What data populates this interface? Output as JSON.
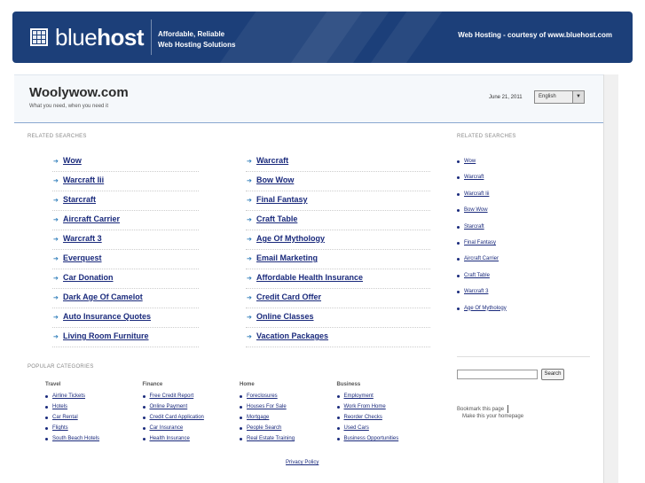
{
  "header": {
    "logo_light": "blue",
    "logo_bold": "host",
    "tagline_1": "Affordable, Reliable",
    "tagline_2": "Web Hosting Solutions",
    "courtesy": "Web Hosting - courtesy of www.bluehost.com",
    "brand_color": "#1c3f79"
  },
  "site": {
    "title": "Woolywow.com",
    "subtitle": "What you need, when you need it",
    "date": "June 21, 2011",
    "language": "English"
  },
  "related": {
    "heading": "RELATED SEARCHES",
    "col1": [
      "Wow",
      "Warcraft Iii",
      "Starcraft",
      "Aircraft Carrier",
      "Warcraft 3",
      "Everquest",
      "Car Donation",
      "Dark Age Of Camelot",
      "Auto Insurance Quotes",
      "Living Room Furniture"
    ],
    "col2": [
      "Warcraft",
      "Bow Wow",
      "Final Fantasy",
      "Craft Table",
      "Age Of Mythology",
      "Email Marketing",
      "Affordable Health Insurance",
      "Credit Card Offer",
      "Online Classes",
      "Vacation Packages"
    ]
  },
  "sidebar": {
    "heading": "RELATED SEARCHES",
    "items": [
      "Wow",
      "Warcraft",
      "Warcraft Iii",
      "Bow Wow",
      "Starcraft",
      "Final Fantasy",
      "Aircraft Carrier",
      "Craft Table",
      "Warcraft 3",
      "Age Of Mythology"
    ],
    "search_button": "Search",
    "bookmark": "Bookmark this page",
    "homepage": "Make this your homepage"
  },
  "popular": {
    "heading": "POPULAR CATEGORIES",
    "categories": [
      {
        "title": "Travel",
        "items": [
          "Airline Tickets",
          "Hotels",
          "Car Rental",
          "Flights",
          "South Beach Hotels"
        ]
      },
      {
        "title": "Finance",
        "items": [
          "Free Credit Report",
          "Online Payment",
          "Credit Card Application",
          "Car Insurance",
          "Health Insurance"
        ]
      },
      {
        "title": "Home",
        "items": [
          "Foreclosures",
          "Houses For Sale",
          "Mortgage",
          "People Search",
          "Real Estate Training"
        ]
      },
      {
        "title": "Business",
        "items": [
          "Employment",
          "Work From Home",
          "Reorder Checks",
          "Used Cars",
          "Business Opportunities"
        ]
      }
    ]
  },
  "footer": {
    "privacy": "Privacy Policy"
  }
}
